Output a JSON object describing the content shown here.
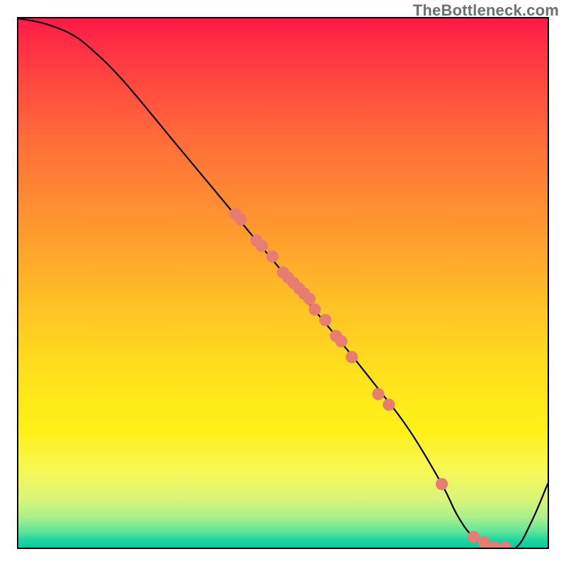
{
  "watermark": "TheBottleneck.com",
  "chart_data": {
    "type": "line",
    "title": "",
    "xlabel": "",
    "ylabel": "",
    "xlim": [
      0,
      100
    ],
    "ylim": [
      0,
      100
    ],
    "background_gradient": {
      "orientation": "vertical",
      "stops": [
        {
          "pos": 0,
          "color": "#ff1a47"
        },
        {
          "pos": 8,
          "color": "#ff3a43"
        },
        {
          "pos": 22,
          "color": "#ff6a3a"
        },
        {
          "pos": 40,
          "color": "#ff9a2f"
        },
        {
          "pos": 55,
          "color": "#ffc425"
        },
        {
          "pos": 68,
          "color": "#ffe21c"
        },
        {
          "pos": 78,
          "color": "#fff218"
        },
        {
          "pos": 86,
          "color": "#f6f85a"
        },
        {
          "pos": 91,
          "color": "#d8f57a"
        },
        {
          "pos": 94.5,
          "color": "#a6ef8d"
        },
        {
          "pos": 97,
          "color": "#5fe39b"
        },
        {
          "pos": 98.5,
          "color": "#1fd6a0"
        },
        {
          "pos": 100,
          "color": "#00cfa0"
        }
      ]
    },
    "series": [
      {
        "name": "bottleneck-curve",
        "type": "line",
        "color": "#000000",
        "x": [
          0,
          5,
          10,
          14,
          20,
          30,
          40,
          50,
          60,
          68,
          74,
          80,
          83,
          86,
          90,
          94,
          97,
          100
        ],
        "y": [
          100,
          99,
          97,
          94,
          88,
          76,
          64,
          52,
          40,
          30,
          22,
          12,
          6,
          2,
          0,
          0,
          5,
          12
        ]
      },
      {
        "name": "sample-points",
        "type": "scatter",
        "color": "#e77c72",
        "x": [
          41,
          42,
          45,
          46,
          48,
          50,
          51,
          52,
          53,
          54,
          55,
          56,
          58,
          60,
          61,
          63,
          68,
          70,
          80,
          86,
          88,
          90,
          92
        ],
        "y": [
          63,
          62,
          58,
          57,
          55,
          52,
          51,
          50,
          49,
          48,
          47,
          45,
          43,
          40,
          39,
          36,
          29,
          27,
          12,
          2,
          1,
          0,
          0
        ]
      }
    ],
    "annotations": []
  }
}
